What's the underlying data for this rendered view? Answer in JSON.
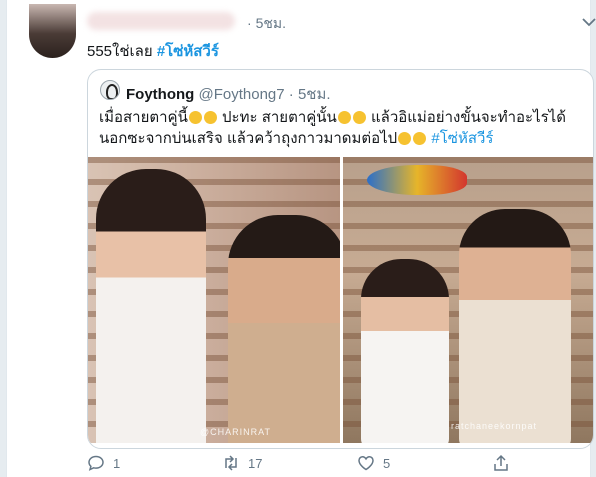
{
  "tweet": {
    "time": "5ชม.",
    "text": "555ใช่เลย",
    "hashtag": "#โซ่หัสวีร์"
  },
  "quote": {
    "name": "Foythong",
    "handle": "@Foythong7",
    "separator": "·",
    "time": "5ชม.",
    "line1a": "เมื่อสายตาคู่นี้",
    "line1b": "ปะทะ สายตาคู่นั้น",
    "line1c": "แล้วอิแม่อย่างขั้นจะทำอะไรได้",
    "line2a": "นอกซะจากบ่นเสริจ แล้วคว้าถุงกาวมาดมต่อไป",
    "line2hash": "#โซ่หัสวีร์",
    "watermark_left": "@CHARINRAT",
    "watermark_right": "ratchaneekornpat"
  },
  "actions": {
    "reply_count": "1",
    "retweet_count": "17",
    "like_count": "5"
  },
  "icons": [
    "chevron-down-icon",
    "reply-icon",
    "retweet-icon",
    "like-icon",
    "share-icon"
  ],
  "colors": {
    "link": "#1b95e0",
    "secondary": "#657786",
    "border": "#ccd6dd"
  }
}
